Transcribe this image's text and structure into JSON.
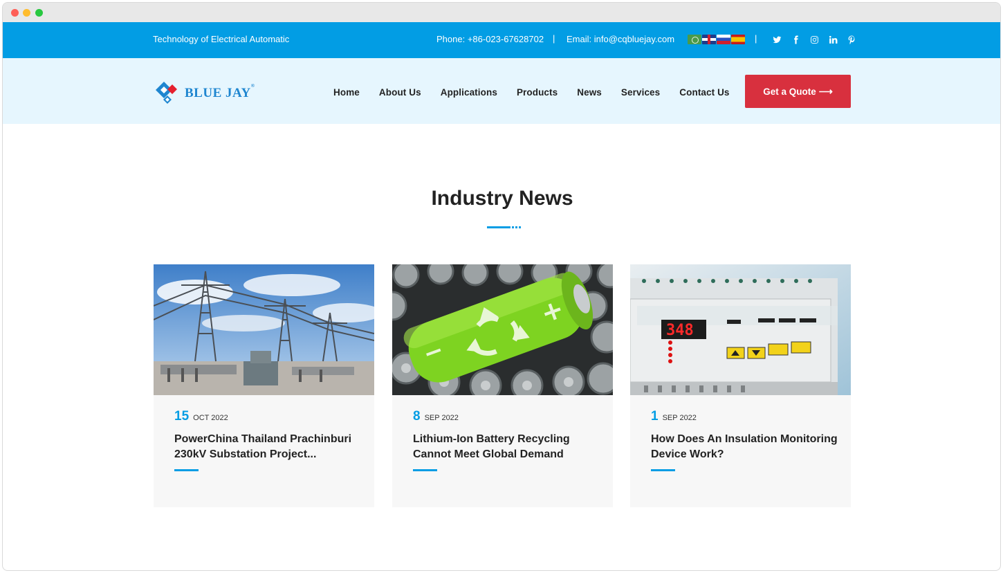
{
  "topbar": {
    "tagline": "Technology of Electrical Automatic",
    "phone": "Phone: +86-023-67628702",
    "separator": "|",
    "email": "Email: info@cqbluejay.com",
    "languages": [
      "arabic-flag-icon",
      "uk-flag-icon",
      "russia-flag-icon",
      "spain-flag-icon"
    ],
    "socials": [
      "twitter-icon",
      "facebook-icon",
      "instagram-icon",
      "linkedin-icon",
      "pinterest-icon"
    ]
  },
  "header": {
    "logo_text": "BLUE JAY",
    "logo_reg": "®",
    "nav": [
      "Home",
      "About Us",
      "Applications",
      "Products",
      "News",
      "Services",
      "Contact Us"
    ],
    "quote_label": "Get a Quote",
    "quote_arrow": "⟶"
  },
  "section": {
    "title": "Industry News"
  },
  "cards": [
    {
      "day": "15",
      "month": "OCT 2022",
      "title": "PowerChina Thailand Prachinburi 230kV Substation Project..."
    },
    {
      "day": "8",
      "month": "SEP 2022",
      "title": "Lithium-Ion Battery Recycling Cannot Meet Global Demand"
    },
    {
      "day": "1",
      "month": "SEP 2022",
      "title": "How Does An Insulation Monitoring Device Work?"
    }
  ],
  "device_display": "348",
  "colors": {
    "primary": "#029de4",
    "accent": "#d8303e",
    "header_bg": "#e6f6fe"
  }
}
